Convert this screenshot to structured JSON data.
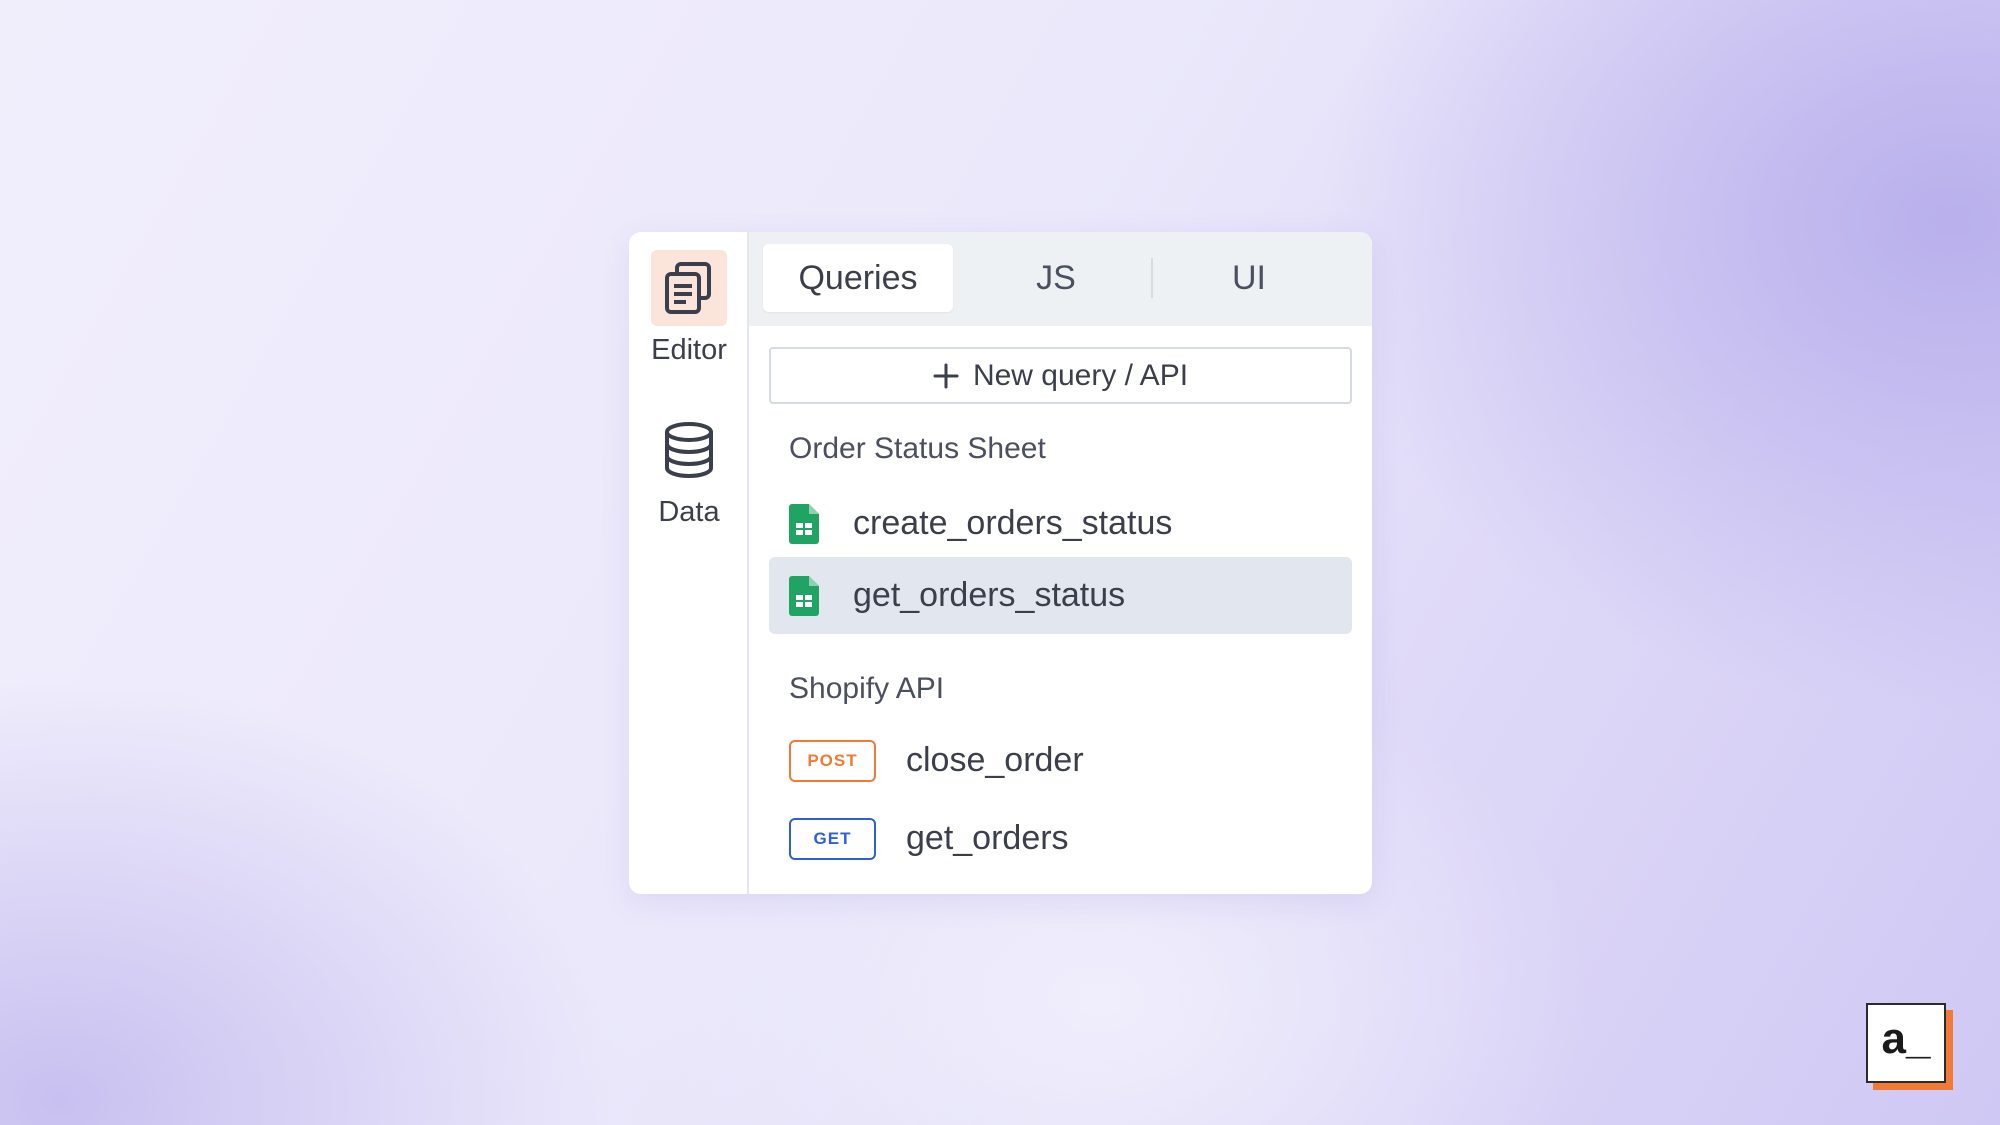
{
  "rail": {
    "items": [
      {
        "label": "Editor",
        "icon": "editor-pages-icon",
        "active": true
      },
      {
        "label": "Data",
        "icon": "database-icon",
        "active": false
      }
    ]
  },
  "tabs": [
    {
      "label": "Queries",
      "active": true
    },
    {
      "label": "JS",
      "active": false
    },
    {
      "label": "UI",
      "active": false
    }
  ],
  "new_button": {
    "label": "New query / API",
    "icon": "plus-icon"
  },
  "groups": [
    {
      "title": "Order Status Sheet",
      "items": [
        {
          "label": "create_orders_status",
          "icon": "google-sheets-icon",
          "selected": false
        },
        {
          "label": "get_orders_status",
          "icon": "google-sheets-icon",
          "selected": true
        }
      ]
    },
    {
      "title": "Shopify API",
      "items": [
        {
          "label": "close_order",
          "method": "POST",
          "method_color": "#f07a36"
        },
        {
          "label": "get_orders",
          "method": "GET",
          "method_color": "#2f5fd6"
        }
      ]
    }
  ],
  "brand": {
    "logo_text": "a_",
    "accent": "#f07a36"
  }
}
